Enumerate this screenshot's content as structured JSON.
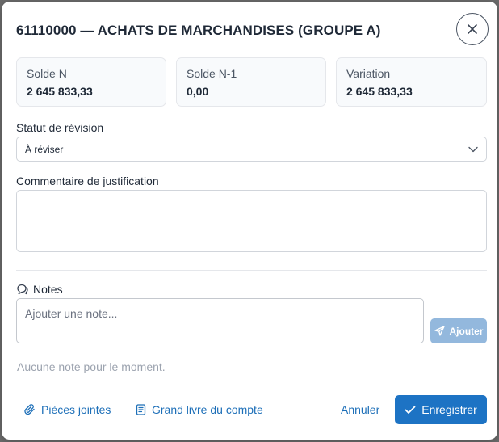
{
  "dialog": {
    "title": "61110000 — ACHATS DE MARCHANDISES (GROUPE A)",
    "close_icon": "close-icon"
  },
  "stats": [
    {
      "label": "Solde N",
      "value": "2 645 833,33"
    },
    {
      "label": "Solde N-1",
      "value": "0,00"
    },
    {
      "label": "Variation",
      "value": "2 645 833,33"
    }
  ],
  "review_status": {
    "label": "Statut de révision",
    "selected": "À réviser"
  },
  "justification": {
    "label": "Commentaire de justification",
    "value": ""
  },
  "notes": {
    "header": "Notes",
    "input_placeholder": "Ajouter une note...",
    "add_label": "Ajouter",
    "empty_text": "Aucune note pour le moment."
  },
  "footer": {
    "attachments_label": "Pièces jointes",
    "ledger_label": "Grand livre du compte",
    "cancel_label": "Annuler",
    "save_label": "Enregistrer"
  },
  "colors": {
    "accent": "#1d73c4",
    "link": "#1d6fb8",
    "disabled_button": "#93b8dd"
  }
}
